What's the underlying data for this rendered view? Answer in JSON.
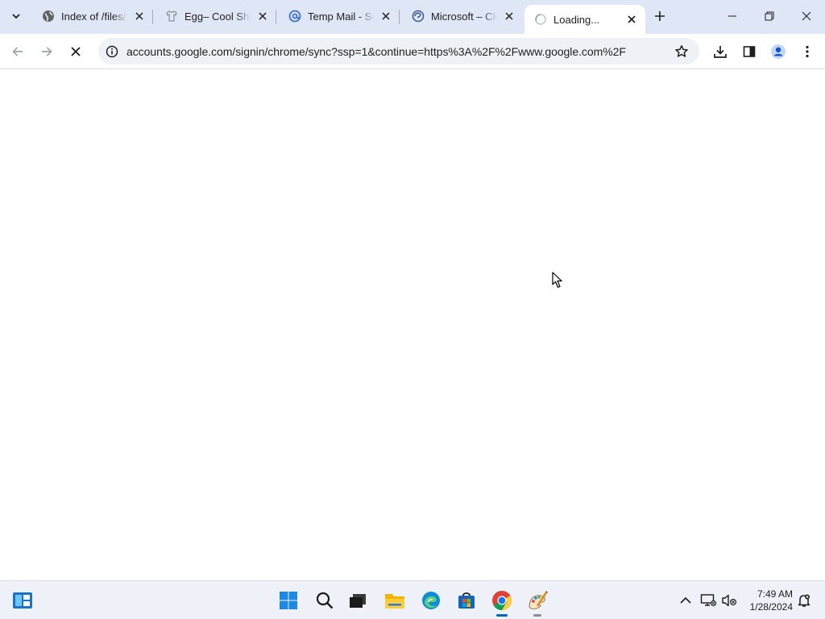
{
  "browser": {
    "tabs": [
      {
        "title": "Index of /files/S",
        "favicon": "globe-icon",
        "active": false
      },
      {
        "title": "Egg– Cool Shirt",
        "favicon": "shirt-icon",
        "active": false
      },
      {
        "title": "Temp Mail - Se",
        "favicon": "at-sign-icon",
        "active": false
      },
      {
        "title": "Microsoft – Clo",
        "favicon": "globe-icon",
        "active": false
      },
      {
        "title": "Loading...",
        "favicon": "loading-spinner-icon",
        "active": true
      }
    ],
    "url": "accounts.google.com/signin/chrome/sync?ssp=1&continue=https%3A%2F%2Fwww.google.com%2F",
    "loading": true
  },
  "taskbar": {
    "apps": [
      "windows-start-icon",
      "search-icon",
      "task-view-icon",
      "file-explorer-icon",
      "edge-icon",
      "store-icon",
      "chrome-icon",
      "paint-icon"
    ],
    "time": "7:49 AM",
    "date": "1/28/2024"
  },
  "colors": {
    "tabstrip": "#dfe6f5",
    "omnibox": "#eef1f6",
    "taskbar": "#eef2f8",
    "accent": "#0b57d0"
  }
}
